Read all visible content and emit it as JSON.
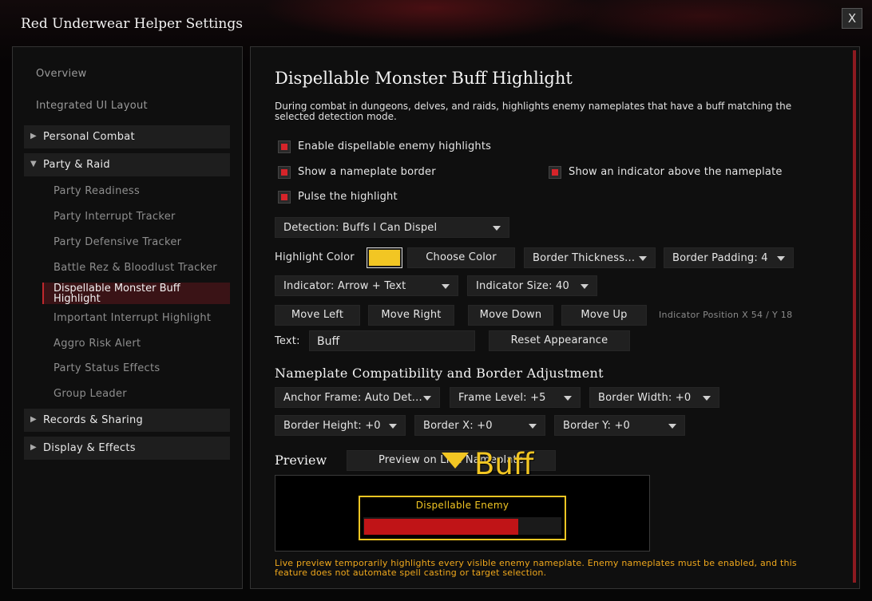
{
  "window": {
    "title": "Red Underwear Helper Settings",
    "close_label": "X"
  },
  "sidebar": {
    "overview": "Overview",
    "integrated_ui_layout": "Integrated UI Layout",
    "personal_combat": {
      "label": "Personal Combat",
      "expanded": false
    },
    "party_raid": {
      "label": "Party & Raid",
      "expanded": true
    },
    "party_items": [
      "Party Readiness",
      "Party Interrupt Tracker",
      "Party Defensive Tracker",
      "Battle Rez & Bloodlust Tracker",
      "Dispellable Monster Buff Highlight",
      "Important Interrupt Highlight",
      "Aggro Risk Alert",
      "Party Status Effects",
      "Group Leader"
    ],
    "records_sharing": {
      "label": "Records & Sharing",
      "expanded": false
    },
    "display_effects": {
      "label": "Display & Effects",
      "expanded": false
    },
    "arrow_collapsed": "▶",
    "arrow_expanded": "▼"
  },
  "main": {
    "title": "Dispellable Monster Buff Highlight",
    "description": "During combat in dungeons, delves, and raids, highlights enemy nameplates that have a buff matching the selected detection mode.",
    "checkboxes": {
      "enable": {
        "label": "Enable dispellable enemy highlights",
        "checked": true
      },
      "border": {
        "label": "Show a nameplate border",
        "checked": true
      },
      "indicator": {
        "label": "Show an indicator above the nameplate",
        "checked": true
      },
      "pulse": {
        "label": "Pulse the highlight",
        "checked": true
      }
    },
    "detection_dropdown": "Detection: Buffs I Can Dispel",
    "highlight_color_label": "Highlight Color",
    "highlight_color": "#f2c623",
    "choose_color_label": "Choose Color",
    "border_thickness_dropdown": "Border Thickness...",
    "border_padding_dropdown": "Border Padding: 4",
    "indicator_dropdown": "Indicator: Arrow + Text",
    "indicator_size_dropdown": "Indicator Size: 40",
    "move_left": "Move Left",
    "move_right": "Move Right",
    "move_down": "Move Down",
    "move_up": "Move Up",
    "indicator_position": "Indicator Position X 54 / Y 18",
    "text_label": "Text:",
    "text_value": "Buff",
    "reset_appearance": "Reset Appearance",
    "compat_title": "Nameplate Compatibility and Border Adjustment",
    "anchor_frame_dropdown": "Anchor Frame: Auto Det...",
    "frame_level_dropdown": "Frame Level: +5",
    "border_width_dropdown": "Border Width: +0",
    "border_height_dropdown": "Border Height: +0",
    "border_x_dropdown": "Border X: +0",
    "border_y_dropdown": "Border Y: +0",
    "preview_title": "Preview",
    "preview_button": "Preview on Live Nameplate",
    "preview": {
      "indicator_text": "Buff",
      "nameplate_name": "Dispellable Enemy",
      "health_fraction": 0.78
    },
    "footer_note": "Live preview temporarily highlights every visible enemy nameplate. Enemy nameplates must be enabled, and this feature does not automate spell casting or target selection."
  },
  "colors": {
    "accent_red": "#d6242a",
    "highlight_yellow": "#f2c623",
    "note_orange": "#f0a81c"
  }
}
